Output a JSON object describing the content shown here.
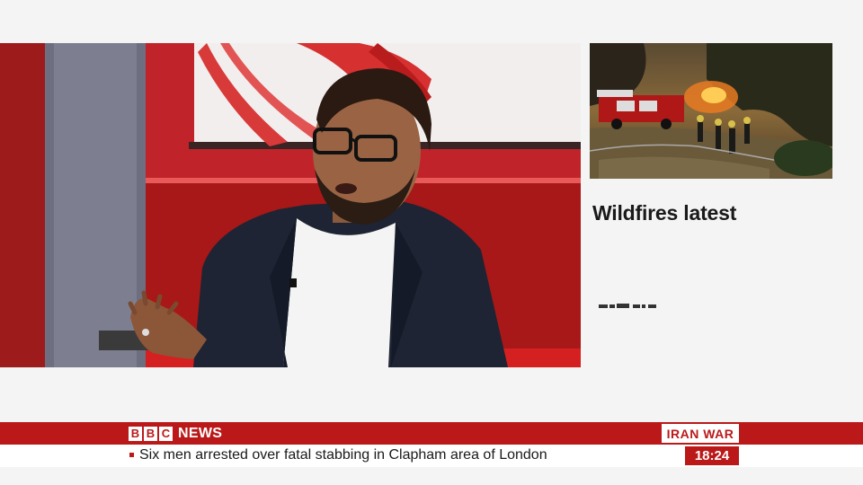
{
  "colors": {
    "bbc_red": "#bb1919",
    "background": "#f4f4f4",
    "ticker_bg": "#ffffff"
  },
  "side_panel": {
    "image_icon": "wildfire-firefighters-photo",
    "headline": "Wildfires latest"
  },
  "main_video": {
    "image_icon": "studio-guest-speaking-video"
  },
  "lower_third": {
    "logo_letters": [
      "B",
      "B",
      "C"
    ],
    "logo_word": "NEWS",
    "topic_tag": "IRAN WAR",
    "ticker_text": "Six men arrested over fatal stabbing in Clapham area of London",
    "clock": "18:24"
  }
}
